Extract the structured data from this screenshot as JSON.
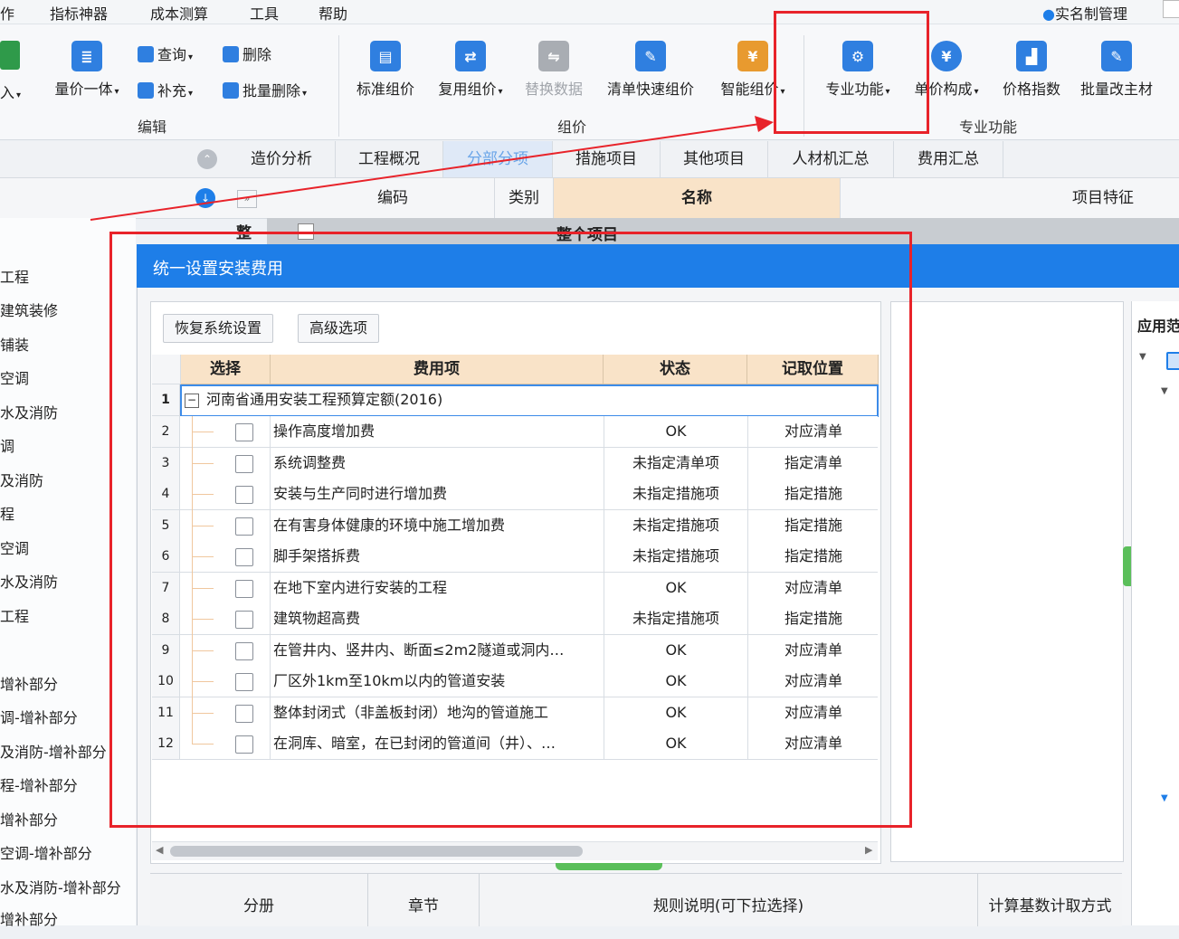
{
  "menu": [
    "作",
    "指标神器",
    "成本测算",
    "工具",
    "帮助"
  ],
  "user_menu": "实名制管理",
  "ribbon": {
    "edit_group": {
      "label": "编辑",
      "import": "入",
      "quantity_price": "量价一体",
      "query": "查询",
      "supplement": "补充",
      "delete": "删除",
      "batch_delete": "批量删除"
    },
    "price_group": {
      "label": "组价",
      "standard": "标准组价",
      "reuse": "复用组价",
      "replace": "替换数据",
      "quick": "清单快速组价",
      "smart": "智能组价"
    },
    "special_group": {
      "label": "专业功能",
      "special": "专业功能",
      "unit_price": "单价构成",
      "price_index": "价格指数",
      "batch_material": "批量改主材"
    }
  },
  "tabs": [
    "造价分析",
    "工程概况",
    "分部分项",
    "措施项目",
    "其他项目",
    "人材机汇总",
    "费用汇总"
  ],
  "grid_headers": {
    "code": "编码",
    "type": "类别",
    "name": "名称",
    "feature": "项目特征"
  },
  "grid_first_row": {
    "mark": "整",
    "name": "整个项目"
  },
  "left_items": [
    "工程",
    "建筑装修",
    "铺装",
    "空调",
    "水及消防",
    "调",
    "及消防",
    "程",
    "空调",
    "水及消防",
    "工程",
    "增补部分",
    "调-增补部分",
    "及消防-增补部分",
    "程-增补部分",
    "增补部分",
    "空调-增补部分",
    "水及消防-增补部分",
    "增补部分"
  ],
  "dialog": {
    "title": "统一设置安装费用",
    "restore_button": "恢复系统设置",
    "advanced_button": "高级选项",
    "columns": {
      "select": "选择",
      "fee_item": "费用项",
      "status": "状态",
      "location": "记取位置"
    },
    "group_row": {
      "num": "1",
      "label": "河南省通用安装工程预算定额(2016)"
    },
    "rows": [
      {
        "num": "2",
        "name": "操作高度增加费",
        "status": "OK",
        "location": "对应清单"
      },
      {
        "num": "3",
        "name": "系统调整费",
        "status": "未指定清单项",
        "location": "指定清单"
      },
      {
        "num": "4",
        "name": "安装与生产同时进行增加费",
        "status": "未指定措施项",
        "location": "指定措施"
      },
      {
        "num": "5",
        "name": "在有害身体健康的环境中施工增加费",
        "status": "未指定措施项",
        "location": "指定措施"
      },
      {
        "num": "6",
        "name": "脚手架搭拆费",
        "status": "未指定措施项",
        "location": "指定措施"
      },
      {
        "num": "7",
        "name": "在地下室内进行安装的工程",
        "status": "OK",
        "location": "对应清单"
      },
      {
        "num": "8",
        "name": "建筑物超高费",
        "status": "未指定措施项",
        "location": "指定措施"
      },
      {
        "num": "9",
        "name": "在管井内、竖井内、断面≤2m2隧道或洞内…",
        "status": "OK",
        "location": "对应清单"
      },
      {
        "num": "10",
        "name": "厂区外1km至10km以内的管道安装",
        "status": "OK",
        "location": "对应清单"
      },
      {
        "num": "11",
        "name": "整体封闭式（非盖板封闭）地沟的管道施工",
        "status": "OK",
        "location": "对应清单"
      },
      {
        "num": "12",
        "name": "在洞库、暗室，在已封闭的管道间（井）、…",
        "status": "OK",
        "location": "对应清单"
      }
    ],
    "right_header": "应用范",
    "bottom_headers": {
      "volume": "分册",
      "chapter": "章节",
      "rule": "规则说明(可下拉选择)",
      "calc": "计算基数计取方式"
    }
  },
  "colors": {
    "title_bar": "#1e7ee8",
    "header_fill": "#f9e3c8",
    "annotation": "#e8232a"
  }
}
